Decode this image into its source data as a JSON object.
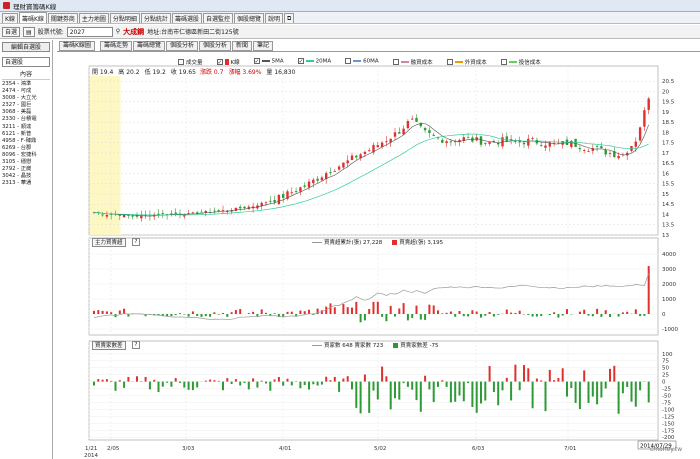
{
  "window": {
    "title": "理財寶籌碼K線"
  },
  "menu_tabs": [
    "K線",
    "籌碼K線",
    "關鍵券商",
    "主力地圖",
    "分點明細",
    "分點統計",
    "籌碼選股",
    "自選監控",
    "個股總覽",
    "說明"
  ],
  "toolbar": {
    "watch_label": "自選",
    "stock_id_label": "股票代號:",
    "stock_id_value": "2027",
    "stock_name": "大成鋼",
    "address": "地址:台南市仁德區新田二街125號"
  },
  "left_panel": {
    "tab": "編輯自選股",
    "group": "自選股",
    "header": "內容",
    "items": [
      "2354 - 鴻準",
      "2474 - 可成",
      "3008 - 大立光",
      "2327 - 國巨",
      "3068 - 美磊",
      "2330 - 台積電",
      "3211 - 順達",
      "6121 - 新普",
      "4958 - F-臻鼎",
      "6269 - 台郡",
      "8096 - 宏捷科",
      "3105 - 穩懋",
      "2792 - 正崴",
      "3042 - 晶技",
      "2313 - 華通"
    ]
  },
  "subtabs": {
    "main": "籌碼K線圖",
    "items": [
      "籌碼走勢",
      "籌碼總覽",
      "個股分析",
      "個股分析",
      "新聞",
      "筆記"
    ]
  },
  "legend": {
    "volume": "成交量",
    "kline": "K線",
    "ma5": "5MA",
    "ma20": "20MA",
    "ma60": "60MA",
    "margin_cost": "融資成本",
    "foreign_cost": "外資成本",
    "trust_cost": "投信成本"
  },
  "price_info": {
    "open": "開 19.4",
    "high": "高 20.2",
    "low": "低 19.2",
    "close": "收 19.65",
    "change": "漲跌 0.7",
    "pct": "漲幅 3.69%",
    "volume": "量 16,830"
  },
  "panel2": {
    "title": "主力買賣超",
    "legend1": "買賣超累計(張) 27,228",
    "legend2": "買賣超(張) 3,195"
  },
  "panel3": {
    "title": "買賣家數差",
    "legend1": "買家數 648 賣家數 723",
    "legend2": "買賣家數差 -75"
  },
  "price_axis": [
    "20.5",
    "20",
    "19.5",
    "19",
    "18.5",
    "18",
    "17.5",
    "17",
    "16.5",
    "16",
    "15.5",
    "15",
    "14.5",
    "14",
    "13.5",
    "13"
  ],
  "p2_axis": [
    "4000",
    "3000",
    "2000",
    "1000",
    "0",
    "-1000"
  ],
  "p3_axis": [
    "100",
    "75",
    "50",
    "25",
    "0",
    "-25",
    "-50",
    "-75",
    "-100",
    "-125",
    "-150",
    "-175",
    "-200"
  ],
  "x_labels": [
    "1/21",
    "2/05",
    "3/03",
    "4/01",
    "5/02",
    "6/03",
    "7/01"
  ],
  "x_year": "2014",
  "current_date": "2014/07/29",
  "watermark": "cmoney.tw",
  "colors": {
    "up": "#e0302c",
    "down": "#2e9a36",
    "accent": "#c00000"
  },
  "chart_data": {
    "type": "candlestick",
    "ylim": [
      13,
      20.75
    ],
    "close_trend": [
      14.1,
      14.0,
      14.0,
      13.9,
      13.95,
      14.0,
      14.05,
      14.0,
      14.1,
      14.15,
      14.2,
      14.3,
      14.4,
      14.6,
      14.8,
      15.1,
      15.4,
      15.8,
      16.2,
      16.5,
      16.9,
      17.2,
      17.6,
      18.0,
      18.6,
      18.0,
      17.7,
      17.6,
      17.7,
      17.6,
      17.5,
      17.6,
      17.5,
      17.6,
      17.5,
      17.4,
      17.5,
      17.3,
      17.2,
      17.0,
      16.9,
      17.6,
      19.65
    ]
  }
}
